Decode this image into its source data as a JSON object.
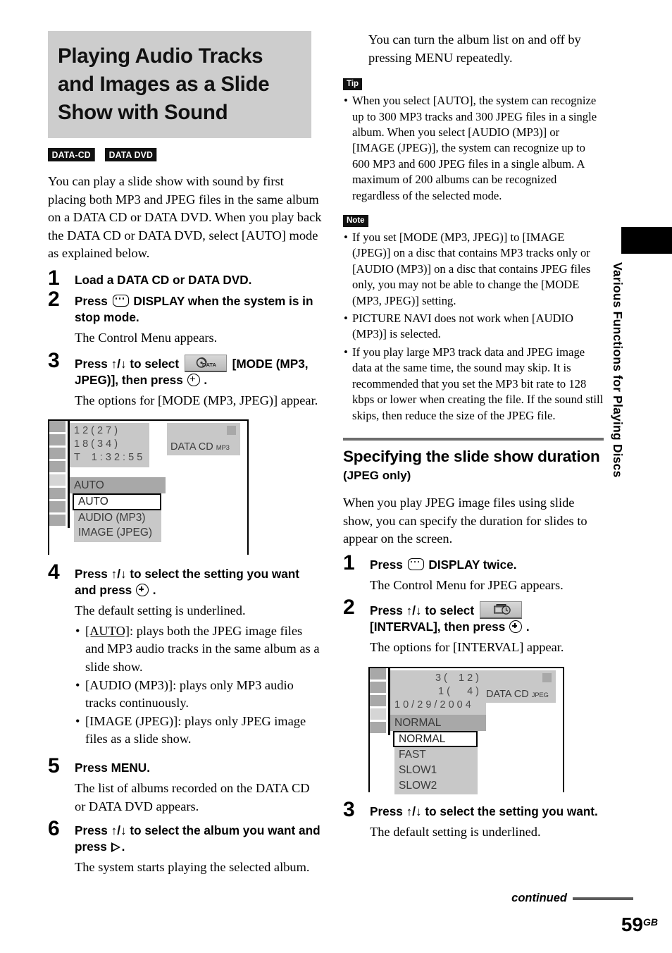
{
  "chapter": {
    "title": "Playing Audio Tracks and Images as a Slide Show with Sound",
    "badges": [
      "DATA-CD",
      "DATA DVD"
    ],
    "intro": "You can play a slide show with sound by first placing both MP3 and JPEG files in the same album on a DATA CD or DATA DVD. When you play back the DATA CD or DATA DVD, select [AUTO] mode as explained below."
  },
  "steps_left": [
    {
      "num": "1",
      "head_pre": "Load a DATA CD or DATA DVD.",
      "head_post": "",
      "body": ""
    },
    {
      "num": "2",
      "head_pre": "Press",
      "head_post": "DISPLAY when the system is in stop mode.",
      "body": "The Control Menu appears."
    },
    {
      "num": "3",
      "head_pre": "Press ↑/↓ to select",
      "head_mid": "[MODE (MP3, JPEG)], then press",
      "head_post": ".",
      "body": "The options for [MODE (MP3, JPEG)] appear."
    },
    {
      "num": "4",
      "head_pre": "Press ↑/↓ to select the setting you want and press",
      "head_post": ".",
      "body": "The default setting is underlined.",
      "bullets": [
        {
          "term": "[AUTO]",
          "underline_term": "AUTO",
          "text": ": plays both the JPEG image files and MP3 audio tracks in the same album as a slide show."
        },
        {
          "term": "[AUDIO (MP3)]",
          "text": ": plays only MP3 audio tracks continuously."
        },
        {
          "term": "[IMAGE (JPEG)]",
          "text": ": plays only JPEG image files as a slide show."
        }
      ]
    },
    {
      "num": "5",
      "head_pre": "Press MENU.",
      "body": "The list of albums recorded on the DATA CD or DATA DVD appears."
    },
    {
      "num": "6",
      "head_pre": "Press ↑/↓ to select the album you want and press",
      "head_post": ".",
      "body": "The system starts playing the selected album."
    }
  ],
  "osd_mode": {
    "info_lines": [
      "1 2 ( 2 7 )",
      "1 8 ( 3 4 )",
      "T    1 : 3 2 : 5 5"
    ],
    "current": "AUTO",
    "options": [
      "AUTO",
      "AUDIO (MP3)",
      "IMAGE (JPEG)"
    ],
    "selected_option": "AUTO",
    "disc_label": "DATA CD",
    "disc_format": "MP3",
    "rail_cells": 8,
    "rail_active_index": 4
  },
  "right_column": {
    "continuation": "You can turn the album list on and off by pressing MENU repeatedly.",
    "tip_label": "Tip",
    "tip_items": [
      "When you select [AUTO], the system can recognize up to 300 MP3 tracks and 300 JPEG files in a single album. When you select [AUDIO (MP3)] or [IMAGE (JPEG)], the system can recognize up to 600 MP3 and 600 JPEG files in a single album. A maximum of 200 albums can be recognized regardless of the selected mode."
    ],
    "note_label": "Note",
    "note_items": [
      "If you set [MODE (MP3, JPEG)] to [IMAGE (JPEG)] on a disc that contains MP3 tracks only or [AUDIO (MP3)] on a disc that contains JPEG files only, you may not be able to change the [MODE (MP3, JPEG)] setting.",
      "PICTURE NAVI does not work when [AUDIO (MP3)] is selected.",
      "If you play large MP3 track data and JPEG image data at the same time, the sound may skip. It is recommended that you set the MP3 bit rate to 128 kbps or lower when creating the file. If the sound still skips, then reduce the size of the JPEG file."
    ]
  },
  "section": {
    "title": "Specifying the slide show duration",
    "subtitle": "(JPEG only)",
    "intro": "When you play JPEG image files using slide show, you can specify the duration for slides to appear on the screen."
  },
  "steps_right": [
    {
      "num": "1",
      "head_pre": "Press",
      "head_post": "DISPLAY twice.",
      "body": "The Control Menu for JPEG appears."
    },
    {
      "num": "2",
      "head_pre": "Press ↑/↓ to select",
      "head_mid": "[INTERVAL], then press",
      "head_post": ".",
      "body": "The options for [INTERVAL] appear."
    },
    {
      "num": "3",
      "head_pre": "Press ↑/↓ to select the setting you want.",
      "body": "The default setting is underlined."
    }
  ],
  "osd_interval": {
    "info_lines": [
      "3 (    1 2 )",
      "1 (      4 )",
      "1 0 / 2 9 / 2 0 0 4"
    ],
    "current": "NORMAL",
    "options": [
      "NORMAL",
      "FAST",
      "SLOW1",
      "SLOW2"
    ],
    "selected_option": "NORMAL",
    "disc_label": "DATA CD",
    "disc_format": "JPEG",
    "rail_cells": 5,
    "rail_active_index": 3
  },
  "side_tab": {
    "text": "Various Functions for Playing Discs"
  },
  "footer": {
    "continued": "continued",
    "page_number": "59",
    "page_suffix": "GB"
  },
  "colors": {
    "title_bg": "#cdcdcd",
    "rule": "#6d6d6d",
    "osd_panel": "#c8c8c8",
    "osd_cell": "#a8a8a8"
  }
}
